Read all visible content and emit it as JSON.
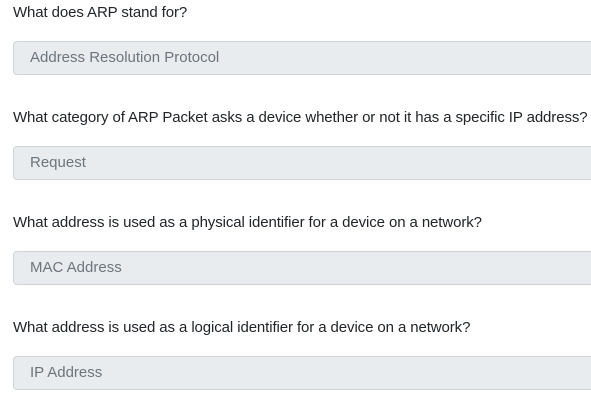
{
  "questions": [
    {
      "question": "What does ARP stand for?",
      "answer": "Address Resolution Protocol"
    },
    {
      "question": "What category of ARP Packet asks a device whether or not it has a specific IP address?",
      "answer": "Request"
    },
    {
      "question": "What address is used as a physical identifier for a device on a network?",
      "answer": "MAC Address"
    },
    {
      "question": "What address is used as a logical identifier for a device on a network?",
      "answer": "IP Address"
    }
  ]
}
